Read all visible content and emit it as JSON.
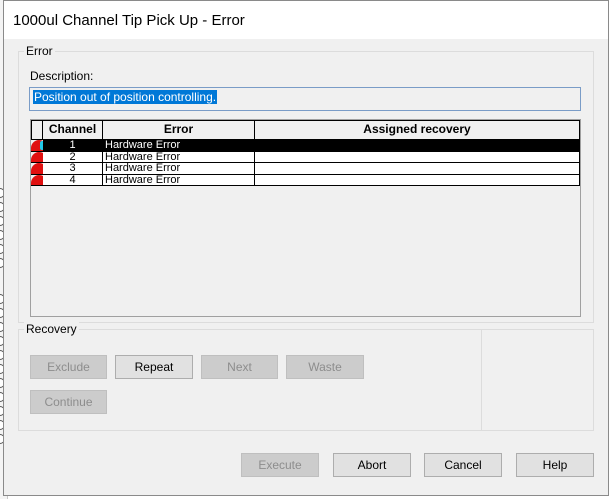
{
  "window": {
    "title": "1000ul Channel Tip Pick Up - Error"
  },
  "error_group": {
    "title": "Error",
    "description_label": "Description:",
    "description_value": "Position out of position controlling."
  },
  "grid": {
    "columns": [
      "Channel",
      "Error",
      "Assigned recovery"
    ],
    "rows": [
      {
        "channel": "1",
        "error": "Hardware Error",
        "recovery": "",
        "selected": true
      },
      {
        "channel": "2",
        "error": "Hardware Error",
        "recovery": ""
      },
      {
        "channel": "3",
        "error": "Hardware Error",
        "recovery": ""
      },
      {
        "channel": "4",
        "error": "Hardware Error",
        "recovery": ""
      }
    ],
    "status_colors": {
      "error": "#e01010",
      "active": "#22c8e8",
      "selection": "#000000"
    }
  },
  "recovery_group": {
    "title": "Recovery",
    "buttons": {
      "exclude": "Exclude",
      "repeat": "Repeat",
      "next": "Next",
      "waste": "Waste",
      "continue": "Continue"
    }
  },
  "footer": {
    "execute": "Execute",
    "abort": "Abort",
    "cancel": "Cancel",
    "help": "Help"
  }
}
